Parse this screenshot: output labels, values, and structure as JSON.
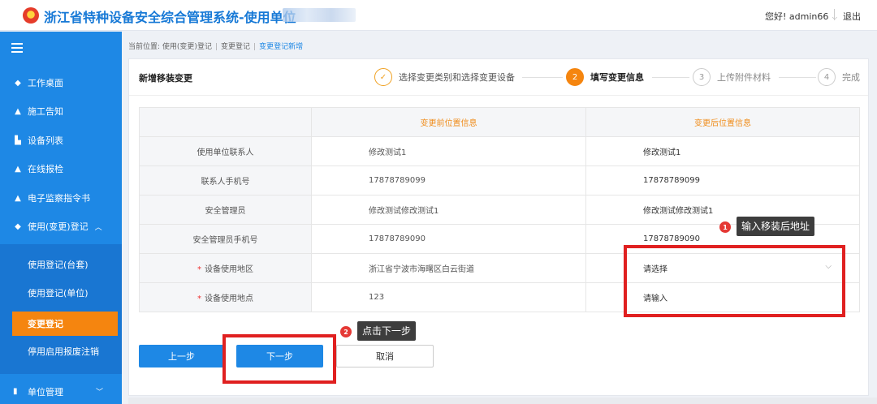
{
  "header": {
    "app_title": "浙江省特种设备安全综合管理系统-使用单位",
    "greeting": "您好! admin66",
    "logout_label": "退出"
  },
  "sidebar": {
    "items": [
      {
        "label": "工作桌面",
        "icon": "diamond-icon"
      },
      {
        "label": "施工告知",
        "icon": "person-icon"
      },
      {
        "label": "设备列表",
        "icon": "people-icon"
      },
      {
        "label": "在线报检",
        "icon": "person-icon"
      },
      {
        "label": "电子监察指令书",
        "icon": "person-gear-icon"
      },
      {
        "label": "使用(变更)登记",
        "icon": "diamond-icon",
        "expanded": true
      }
    ],
    "subitems": [
      {
        "label": "使用登记(台套)"
      },
      {
        "label": "使用登记(单位)"
      },
      {
        "label": "变更登记",
        "active": true
      },
      {
        "label": "停用启用报废注销"
      }
    ],
    "bottom_item": {
      "label": "单位管理",
      "icon": "bookmark-icon"
    }
  },
  "breadcrumb": {
    "prefix": "当前位置:",
    "items": [
      "使用(变更)登记",
      "变更登记",
      "变更登记新增"
    ]
  },
  "page": {
    "title": "新增移装变更",
    "steps": [
      {
        "label": "选择变更类别和选择变更设备",
        "number": "✓",
        "state": "done"
      },
      {
        "label": "填写变更信息",
        "number": "2",
        "state": "active"
      },
      {
        "label": "上传附件材料",
        "number": "3",
        "state": "pending"
      },
      {
        "label": "完成",
        "number": "4",
        "state": "pending"
      }
    ]
  },
  "table": {
    "headers": [
      "",
      "变更前位置信息",
      "变更后位置信息"
    ],
    "rows": [
      {
        "label": "使用单位联系人",
        "before": "修改测试1",
        "after": "修改测试1"
      },
      {
        "label": "联系人手机号",
        "before": "17878789099",
        "after": "17878789099"
      },
      {
        "label": "安全管理员",
        "before": "修改测试修改测试1",
        "after": "修改测试修改测试1"
      },
      {
        "label": "安全管理员手机号",
        "before": "17878789090",
        "after": "17878789090"
      },
      {
        "label": "设备使用地区",
        "required": true,
        "before": "浙江省宁波市海曙区白云街道",
        "after_placeholder": "请选择"
      },
      {
        "label": "设备使用地点",
        "required": true,
        "before": "123",
        "after_placeholder": "请输入"
      }
    ]
  },
  "buttons": {
    "prev": "上一步",
    "next": "下一步",
    "cancel": "取消"
  },
  "annotations": [
    {
      "number": "1",
      "text": "输入移装后地址"
    },
    {
      "number": "2",
      "text": "点击下一步"
    }
  ],
  "colors": {
    "primary": "#1e88e5",
    "accent": "#f5850f",
    "annotation_red": "#e02020"
  }
}
